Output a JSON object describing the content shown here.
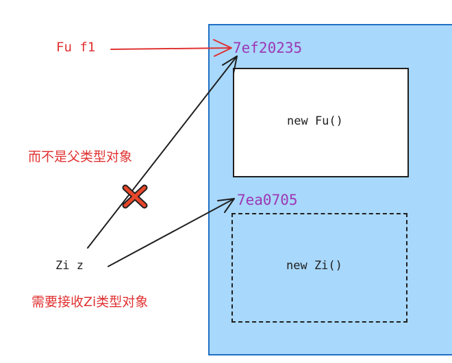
{
  "ref_fu": "Fu f1",
  "ref_zi": "Zi z",
  "addr_fu": "7ef20235",
  "addr_zi": "7ea0705",
  "obj_fu_label": "new Fu()",
  "obj_zi_label": "new Zi()",
  "note_not_parent": "而不是父类型对象",
  "note_need_zi": "需要接收Zi类型对象",
  "colors": {
    "red": "#e03131",
    "purple": "#9c36b5",
    "heap_fill": "#a8d8fb",
    "heap_border": "#1e6fc4",
    "ink": "#1e1e1e"
  }
}
